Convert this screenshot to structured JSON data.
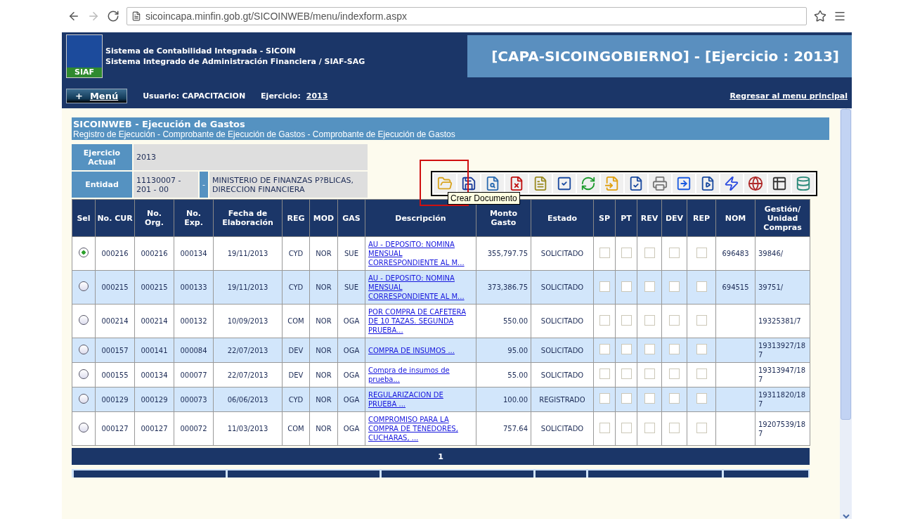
{
  "browser": {
    "url": "sicoincapa.minfin.gob.gt/SICOINWEB/menu/indexform.aspx"
  },
  "header": {
    "logo_text": "SIAF",
    "title_lines": [
      "Sistema de Contabilidad Integrada - SICOIN",
      "Sistema Integrado de Administración Financiera / SIAF-SAG"
    ],
    "banner": "[CAPA-SICOINGOBIERNO] - [Ejercicio : 2013]"
  },
  "nav": {
    "menu_icon": "+",
    "menu_label": "Menú",
    "user": "Usuario: CAPACITACION",
    "year_label": "Ejercicio:",
    "year_link": "2013",
    "back_link": "Regresar al menu principal"
  },
  "panel": {
    "title": "SICOINWEB - Ejecución de Gastos",
    "breadcrumb": "Registro de Ejecución - Comprobante de Ejecución de Gastos - Comprobante de Ejecución de Gastos"
  },
  "info": {
    "year_label": "Ejercicio Actual",
    "year_value": "2013",
    "entity_label": "Entidad",
    "entity_code": "11130007 - 201 - 00",
    "entity_sep": "-",
    "entity_name": "MINISTERIO DE FINANZAS P?BLICAS, DIRECCION FINANCIERA"
  },
  "toolbar": {
    "tooltip": "Crear Documento"
  },
  "table": {
    "columns": [
      "Sel",
      "No. CUR",
      "No. Org.",
      "No. Exp.",
      "Fecha de Elaboración",
      "REG",
      "MOD",
      "GAS",
      "Descripción",
      "Monto Gasto",
      "Estado",
      "SP",
      "PT",
      "REV",
      "DEV",
      "REP",
      "NOM",
      "Gestión/ Unidad Compras"
    ],
    "rows": [
      {
        "selected": true,
        "cur": "000216",
        "org": "000216",
        "exp": "000134",
        "date": "19/11/2013",
        "reg": "CYD",
        "mod": "NOR",
        "gas": "SUE",
        "desc": "AU - DEPOSITO: NOMINA MENSUAL CORRESPONDIENTE AL M...",
        "amount": "355,797.75",
        "status": "SOLICITADO",
        "checks": [
          false,
          false,
          false,
          false,
          false
        ],
        "nom": "696483",
        "gestion": "39846/"
      },
      {
        "selected": false,
        "cur": "000215",
        "org": "000215",
        "exp": "000133",
        "date": "19/11/2013",
        "reg": "CYD",
        "mod": "NOR",
        "gas": "SUE",
        "desc": "AU - DEPOSITO: NOMINA MENSUAL CORRESPONDIENTE AL M...",
        "amount": "373,386.75",
        "status": "SOLICITADO",
        "checks": [
          false,
          false,
          false,
          false,
          false
        ],
        "nom": "694515",
        "gestion": "39751/"
      },
      {
        "selected": false,
        "cur": "000214",
        "org": "000214",
        "exp": "000132",
        "date": "10/09/2013",
        "reg": "COM",
        "mod": "NOR",
        "gas": "OGA",
        "desc": "POR COMPRA DE CAFETERA DE 10 TAZAS. SEGUNDA PRUEBA...",
        "amount": "550.00",
        "status": "SOLICITADO",
        "checks": [
          false,
          false,
          false,
          false,
          false
        ],
        "gestion": "19325381/7"
      },
      {
        "selected": false,
        "cur": "000157",
        "org": "000141",
        "exp": "000084",
        "date": "22/07/2013",
        "reg": "DEV",
        "mod": "NOR",
        "gas": "OGA",
        "desc": "COMPRA DE INSUMOS ...",
        "amount": "95.00",
        "status": "SOLICITADO",
        "checks": [
          false,
          false,
          false,
          false,
          false
        ],
        "gestion": "19313927/187"
      },
      {
        "selected": false,
        "cur": "000155",
        "org": "000134",
        "exp": "000077",
        "date": "22/07/2013",
        "reg": "DEV",
        "mod": "NOR",
        "gas": "OGA",
        "desc": "Compra de insumos de prueba...",
        "amount": "55.00",
        "status": "SOLICITADO",
        "checks": [
          false,
          false,
          false,
          false,
          false
        ],
        "gestion": "19313947/187"
      },
      {
        "selected": false,
        "cur": "000129",
        "org": "000129",
        "exp": "000073",
        "date": "06/06/2013",
        "reg": "CYD",
        "mod": "NOR",
        "gas": "OGA",
        "desc": "REGULARIZACION DE PRUEBA ...",
        "amount": "100.00",
        "status": "REGISTRADO",
        "checks": [
          false,
          false,
          false,
          false,
          false
        ],
        "gestion": "19311820/187"
      },
      {
        "selected": false,
        "cur": "000127",
        "org": "000127",
        "exp": "000072",
        "date": "11/03/2013",
        "reg": "COM",
        "mod": "NOR",
        "gas": "OGA",
        "desc": "COMPROMISO PARA LA COMPRA DE TENEDORES, CUCHARAS, ...",
        "amount": "757.64",
        "status": "SOLICITADO",
        "checks": [
          false,
          false,
          false,
          false,
          false
        ],
        "gestion": "19207539/187"
      }
    ]
  },
  "pager": {
    "page": "1"
  }
}
